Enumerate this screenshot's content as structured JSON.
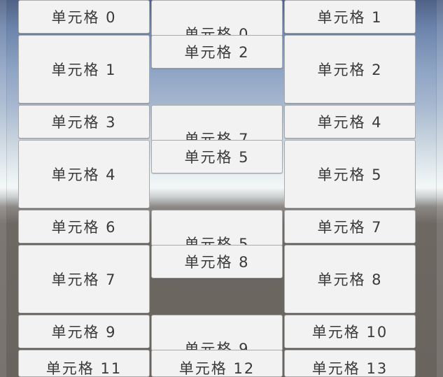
{
  "cells": {
    "c0": "单元格 0",
    "c1r": "单元格 1",
    "c1": "单元格 1",
    "c2": "单元格 2",
    "c2r": "单元格 2",
    "c3": "单元格 3",
    "c4r": "单元格 4",
    "c4": "单元格 4",
    "c5": "单元格 5",
    "c5r": "单元格 5",
    "c6": "单元格 6",
    "c7r": "单元格 7",
    "c7": "单元格 7",
    "c8": "单元格 8",
    "c8r": "单元格 8",
    "c9": "单元格 9",
    "c10": "单元格 10",
    "c11": "单元格 11",
    "c12": "单元格 12",
    "c13": "单元格 13",
    "hidden_a": "单元格 0",
    "hidden_b": "单元格 7",
    "hidden_c": "单元格 5",
    "hidden_d": "单元格 9"
  }
}
